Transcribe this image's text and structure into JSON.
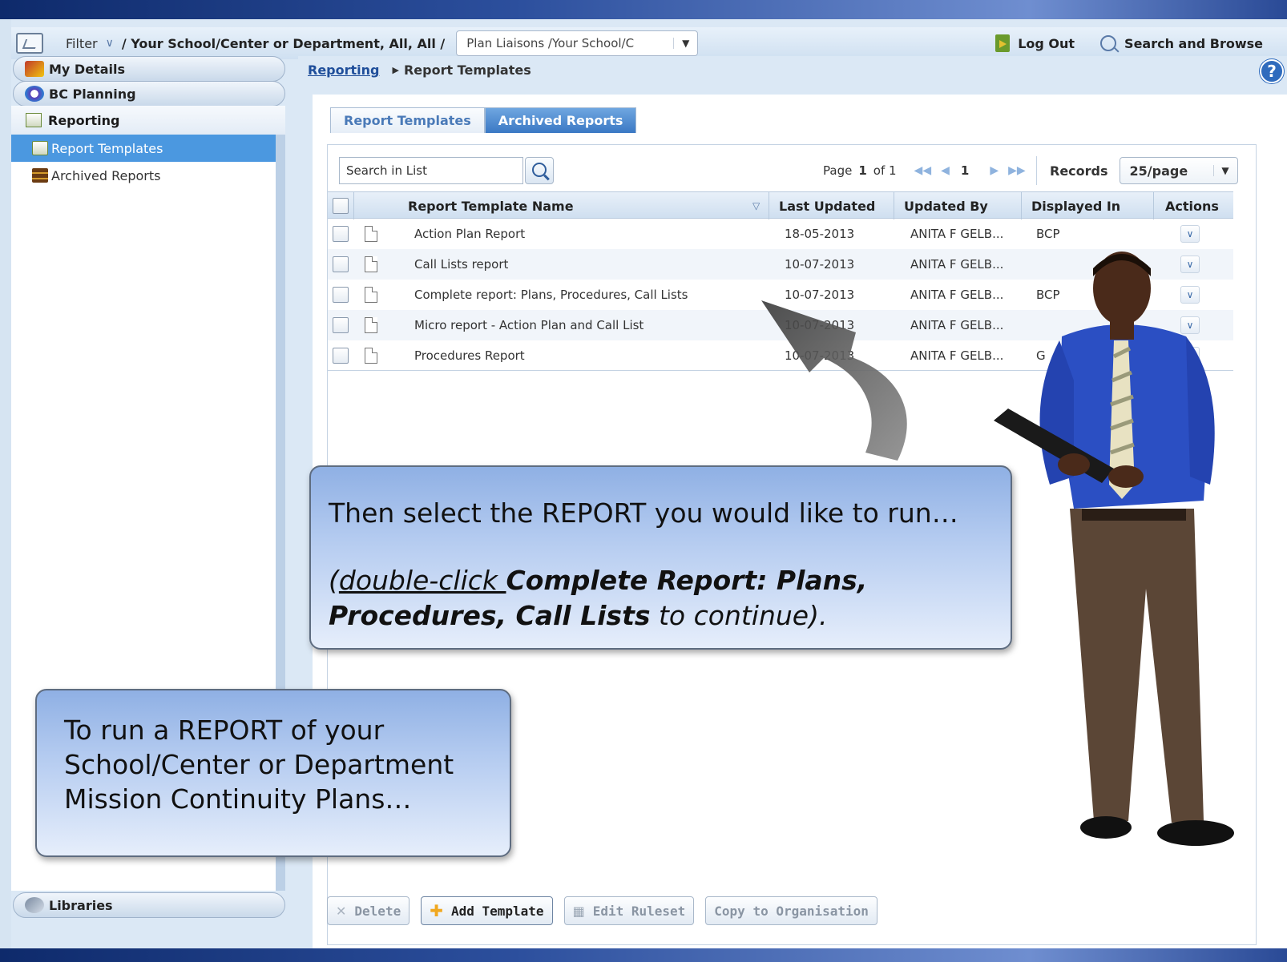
{
  "filterbar": {
    "filter_label": "Filter",
    "scope": "/ Your School/Center or Department, All, All /",
    "plan_select_value": "Plan Liaisons /Your School/C",
    "logout_label": "Log Out",
    "search_browse_label": "Search and Browse"
  },
  "sidebar": {
    "tabs": [
      {
        "label": "My Details"
      },
      {
        "label": "BC Planning"
      }
    ],
    "section": "Reporting",
    "items": [
      {
        "label": "Report Templates",
        "active": true
      },
      {
        "label": "Archived Reports",
        "active": false
      }
    ],
    "bottom_tab": "Libraries"
  },
  "breadcrumb": {
    "root": "Reporting",
    "current": "Report Templates"
  },
  "tabs": [
    {
      "label": "Report Templates"
    },
    {
      "label": "Archived Reports"
    }
  ],
  "toolbar": {
    "search_placeholder": "Search in List",
    "page_label": "Page",
    "page_value": "1",
    "of_label": "of 1",
    "current_page": "1",
    "records_label": "Records",
    "records_per_page": "25/page"
  },
  "table": {
    "columns": [
      "Report Template Name",
      "Last Updated",
      "Updated By",
      "Displayed In",
      "Actions"
    ],
    "rows": [
      {
        "name": "Action Plan Report",
        "updated": "18-05-2013",
        "by": "ANITA F GELB...",
        "displayed": "BCP"
      },
      {
        "name": "Call Lists report",
        "updated": "10-07-2013",
        "by": "ANITA F GELB...",
        "displayed": ""
      },
      {
        "name": "Complete report: Plans, Procedures, Call Lists",
        "updated": "10-07-2013",
        "by": "ANITA F GELB...",
        "displayed": "BCP"
      },
      {
        "name": "Micro report - Action Plan and Call List",
        "updated": "10-07-2013",
        "by": "ANITA F GELB...",
        "displayed": ""
      },
      {
        "name": "Procedures Report",
        "updated": "10-07-2013",
        "by": "ANITA F GELB...",
        "displayed": "G"
      }
    ]
  },
  "buttons": {
    "delete": "Delete",
    "add_template": "Add Template",
    "edit_ruleset": "Edit Ruleset",
    "copy_to_org": "Copy to Organisation"
  },
  "callouts": {
    "main_line1": "Then select the REPORT you would like to run…",
    "main_pre": "(",
    "main_link": "double-click ",
    "main_bold": "Complete Report: Plans, Procedures, Call Lists",
    "main_post": " to continue).",
    "side_text": "To run a REPORT of your School/Center or Department Mission Continuity Plans…"
  }
}
